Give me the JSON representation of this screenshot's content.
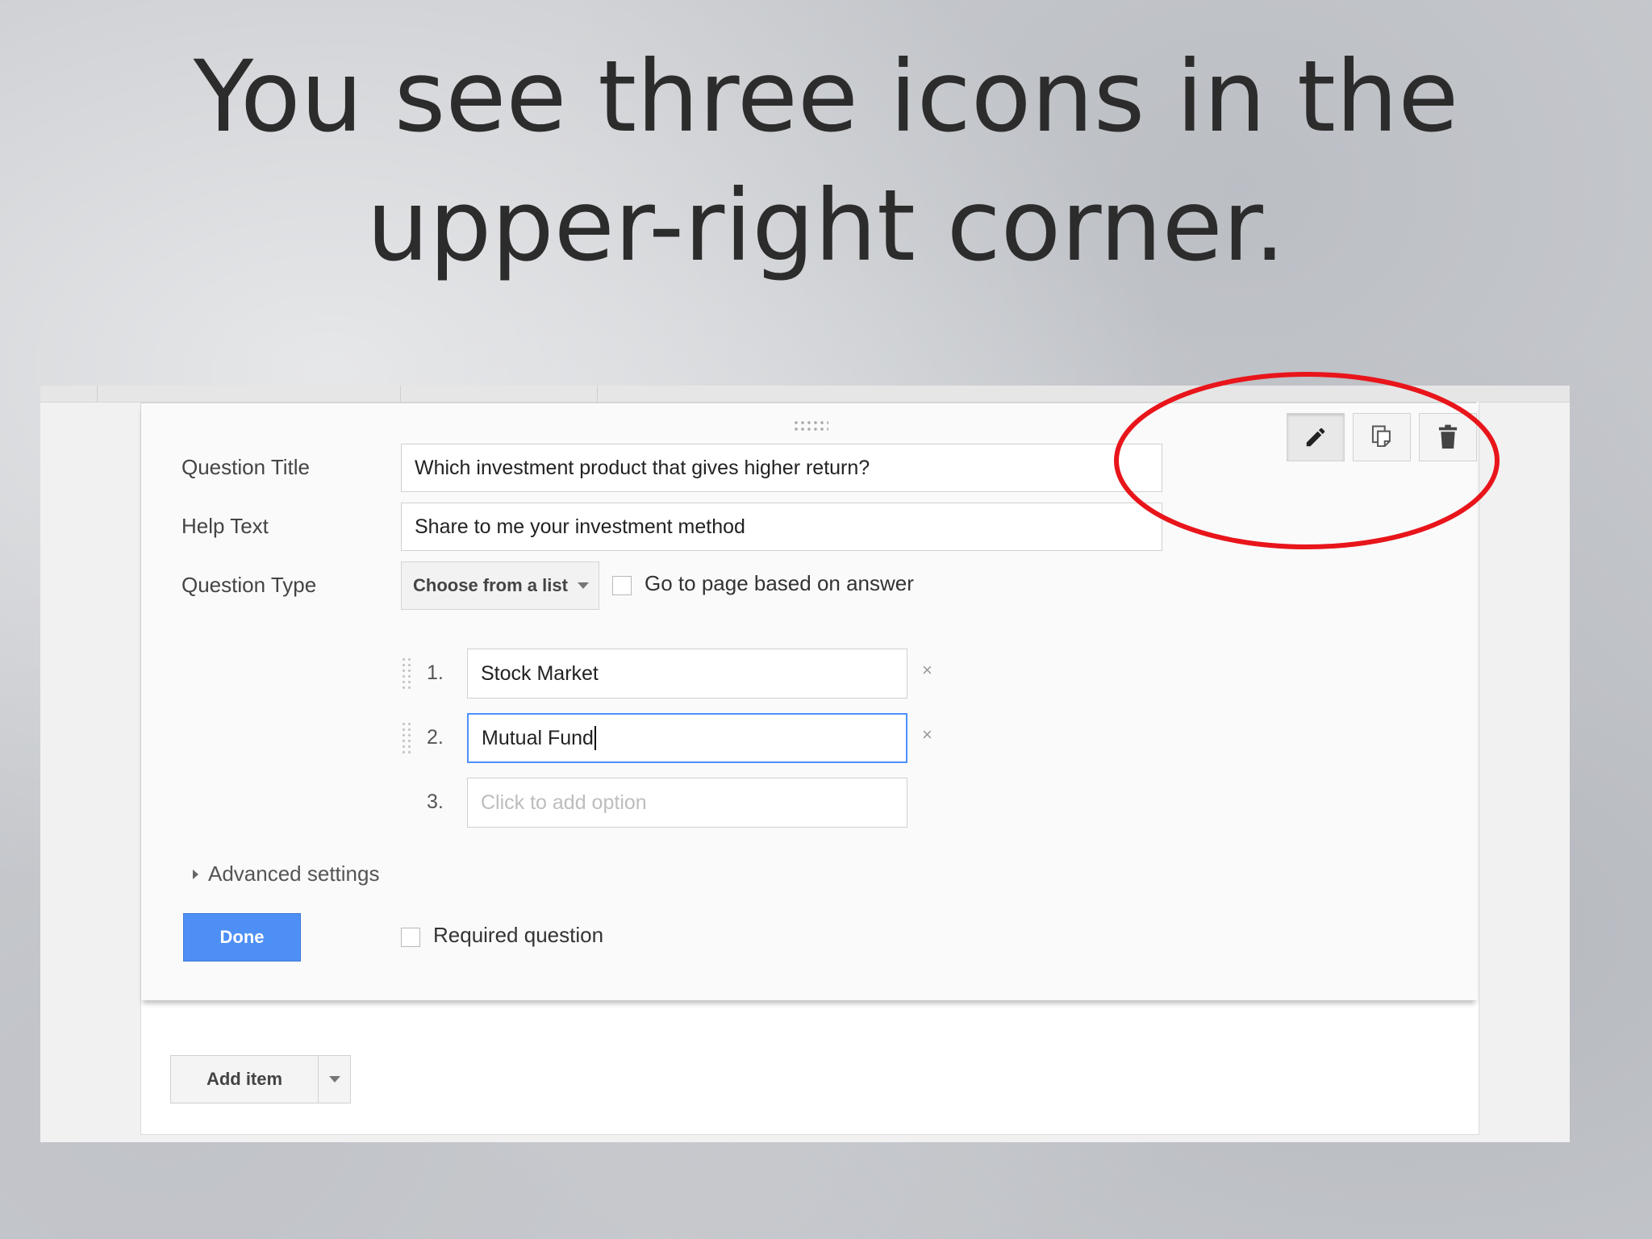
{
  "slide": {
    "title_line1": "You see three icons in the",
    "title_line2": "upper-right corner."
  },
  "question": {
    "title_label": "Question Title",
    "title_value": "Which investment product that gives higher return?",
    "help_label": "Help Text",
    "help_value": "Share to me your investment method",
    "type_label": "Question Type",
    "type_selected": "Choose from a list",
    "go_to_page_label": "Go to page based on answer",
    "go_to_page_checked": false
  },
  "options": [
    {
      "number": "1.",
      "value": "Stock Market"
    },
    {
      "number": "2.",
      "value": "Mutual Fund"
    },
    {
      "number": "3.",
      "placeholder": "Click to add option"
    }
  ],
  "toolbar": {
    "edit_icon": "pencil-icon",
    "duplicate_icon": "duplicate-icon",
    "delete_icon": "trash-icon"
  },
  "footer": {
    "advanced_label": "Advanced settings",
    "done_label": "Done",
    "required_label": "Required question",
    "required_checked": false,
    "add_item_label": "Add item"
  },
  "colors": {
    "done_button": "#4d8ff5",
    "focus_border": "#4d90fe",
    "highlight_circle": "#e8151b"
  }
}
